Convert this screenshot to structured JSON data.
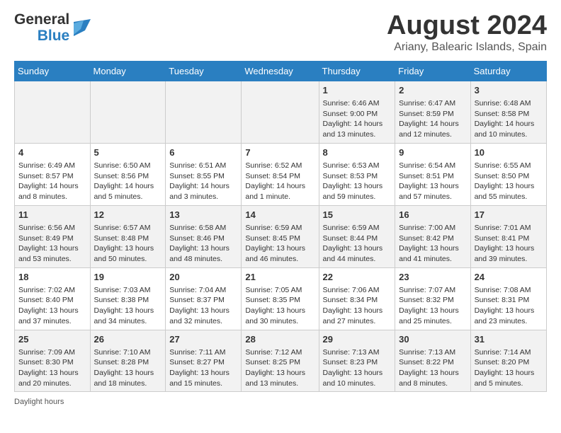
{
  "header": {
    "logo_general": "General",
    "logo_blue": "Blue",
    "month_title": "August 2024",
    "location": "Ariany, Balearic Islands, Spain"
  },
  "weekdays": [
    "Sunday",
    "Monday",
    "Tuesday",
    "Wednesday",
    "Thursday",
    "Friday",
    "Saturday"
  ],
  "rows": [
    [
      {
        "day": "",
        "info": ""
      },
      {
        "day": "",
        "info": ""
      },
      {
        "day": "",
        "info": ""
      },
      {
        "day": "",
        "info": ""
      },
      {
        "day": "1",
        "info": "Sunrise: 6:46 AM\nSunset: 9:00 PM\nDaylight: 14 hours\nand 13 minutes."
      },
      {
        "day": "2",
        "info": "Sunrise: 6:47 AM\nSunset: 8:59 PM\nDaylight: 14 hours\nand 12 minutes."
      },
      {
        "day": "3",
        "info": "Sunrise: 6:48 AM\nSunset: 8:58 PM\nDaylight: 14 hours\nand 10 minutes."
      }
    ],
    [
      {
        "day": "4",
        "info": "Sunrise: 6:49 AM\nSunset: 8:57 PM\nDaylight: 14 hours\nand 8 minutes."
      },
      {
        "day": "5",
        "info": "Sunrise: 6:50 AM\nSunset: 8:56 PM\nDaylight: 14 hours\nand 5 minutes."
      },
      {
        "day": "6",
        "info": "Sunrise: 6:51 AM\nSunset: 8:55 PM\nDaylight: 14 hours\nand 3 minutes."
      },
      {
        "day": "7",
        "info": "Sunrise: 6:52 AM\nSunset: 8:54 PM\nDaylight: 14 hours\nand 1 minute."
      },
      {
        "day": "8",
        "info": "Sunrise: 6:53 AM\nSunset: 8:53 PM\nDaylight: 13 hours\nand 59 minutes."
      },
      {
        "day": "9",
        "info": "Sunrise: 6:54 AM\nSunset: 8:51 PM\nDaylight: 13 hours\nand 57 minutes."
      },
      {
        "day": "10",
        "info": "Sunrise: 6:55 AM\nSunset: 8:50 PM\nDaylight: 13 hours\nand 55 minutes."
      }
    ],
    [
      {
        "day": "11",
        "info": "Sunrise: 6:56 AM\nSunset: 8:49 PM\nDaylight: 13 hours\nand 53 minutes."
      },
      {
        "day": "12",
        "info": "Sunrise: 6:57 AM\nSunset: 8:48 PM\nDaylight: 13 hours\nand 50 minutes."
      },
      {
        "day": "13",
        "info": "Sunrise: 6:58 AM\nSunset: 8:46 PM\nDaylight: 13 hours\nand 48 minutes."
      },
      {
        "day": "14",
        "info": "Sunrise: 6:59 AM\nSunset: 8:45 PM\nDaylight: 13 hours\nand 46 minutes."
      },
      {
        "day": "15",
        "info": "Sunrise: 6:59 AM\nSunset: 8:44 PM\nDaylight: 13 hours\nand 44 minutes."
      },
      {
        "day": "16",
        "info": "Sunrise: 7:00 AM\nSunset: 8:42 PM\nDaylight: 13 hours\nand 41 minutes."
      },
      {
        "day": "17",
        "info": "Sunrise: 7:01 AM\nSunset: 8:41 PM\nDaylight: 13 hours\nand 39 minutes."
      }
    ],
    [
      {
        "day": "18",
        "info": "Sunrise: 7:02 AM\nSunset: 8:40 PM\nDaylight: 13 hours\nand 37 minutes."
      },
      {
        "day": "19",
        "info": "Sunrise: 7:03 AM\nSunset: 8:38 PM\nDaylight: 13 hours\nand 34 minutes."
      },
      {
        "day": "20",
        "info": "Sunrise: 7:04 AM\nSunset: 8:37 PM\nDaylight: 13 hours\nand 32 minutes."
      },
      {
        "day": "21",
        "info": "Sunrise: 7:05 AM\nSunset: 8:35 PM\nDaylight: 13 hours\nand 30 minutes."
      },
      {
        "day": "22",
        "info": "Sunrise: 7:06 AM\nSunset: 8:34 PM\nDaylight: 13 hours\nand 27 minutes."
      },
      {
        "day": "23",
        "info": "Sunrise: 7:07 AM\nSunset: 8:32 PM\nDaylight: 13 hours\nand 25 minutes."
      },
      {
        "day": "24",
        "info": "Sunrise: 7:08 AM\nSunset: 8:31 PM\nDaylight: 13 hours\nand 23 minutes."
      }
    ],
    [
      {
        "day": "25",
        "info": "Sunrise: 7:09 AM\nSunset: 8:30 PM\nDaylight: 13 hours\nand 20 minutes."
      },
      {
        "day": "26",
        "info": "Sunrise: 7:10 AM\nSunset: 8:28 PM\nDaylight: 13 hours\nand 18 minutes."
      },
      {
        "day": "27",
        "info": "Sunrise: 7:11 AM\nSunset: 8:27 PM\nDaylight: 13 hours\nand 15 minutes."
      },
      {
        "day": "28",
        "info": "Sunrise: 7:12 AM\nSunset: 8:25 PM\nDaylight: 13 hours\nand 13 minutes."
      },
      {
        "day": "29",
        "info": "Sunrise: 7:13 AM\nSunset: 8:23 PM\nDaylight: 13 hours\nand 10 minutes."
      },
      {
        "day": "30",
        "info": "Sunrise: 7:13 AM\nSunset: 8:22 PM\nDaylight: 13 hours\nand 8 minutes."
      },
      {
        "day": "31",
        "info": "Sunrise: 7:14 AM\nSunset: 8:20 PM\nDaylight: 13 hours\nand 5 minutes."
      }
    ]
  ],
  "footer": {
    "daylight_label": "Daylight hours"
  }
}
